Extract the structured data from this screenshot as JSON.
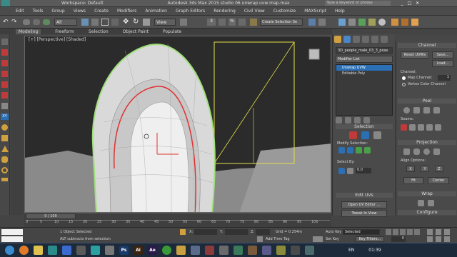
{
  "title": {
    "workspace": "Workspace: Default",
    "app_title": "Autodesk 3ds Max 2015  studio 06 unwrap uvw map.max",
    "search_placeholder": "Type a keyword or phrase"
  },
  "menu": [
    "Edit",
    "Tools",
    "Group",
    "Views",
    "Create",
    "Modifiers",
    "Animation",
    "Graph Editors",
    "Rendering",
    "Civil View",
    "Customize",
    "MAXScript",
    "Help"
  ],
  "toolbar": {
    "selection_filter": "All",
    "ref_coord": "View",
    "sel_set": "Create Selection Se"
  },
  "ribbon_tabs": [
    "Modeling",
    "Freeform",
    "Selection",
    "Object Paint",
    "Populate"
  ],
  "viewport": {
    "label": "[+] [Perspective] [Shaded]"
  },
  "command_panel": {
    "object_name": "3D_people_male_03_3_pose",
    "modifier_list": "Modifier List",
    "stack": [
      "Unwrap UVW",
      "Editable Poly"
    ],
    "selection_title": "Selection",
    "modify_selection": "Modify Selection:",
    "select_by": "Select By:",
    "select_by_value": "0.0",
    "edit_uvs_title": "Edit UVs",
    "open_uv_editor": "Open UV Editor ...",
    "tweak_in_view": "Tweak In View"
  },
  "uv_panel": {
    "channel_title": "Channel",
    "reset_uvws": "Reset UVWs",
    "save": "Save...",
    "load": "Load...",
    "channel_label": "Channel:",
    "map_channel_label": "Map Channel:",
    "map_channel_value": "1",
    "vertex_color_channel": "Vertex Color Channel",
    "peel_title": "Peel",
    "seams_label": "Seams:",
    "projection_title": "Projection",
    "align_options": "Align Options:",
    "align": [
      "X",
      "Y",
      "Z"
    ],
    "fit": "Fit",
    "center": "Center",
    "wrap_title": "Wrap",
    "configure_title": "Configure"
  },
  "timeline": {
    "frame": "0 / 100",
    "ticks": [
      "0",
      "5",
      "10",
      "15",
      "20",
      "25",
      "30",
      "35",
      "40",
      "45",
      "50",
      "55",
      "60",
      "65",
      "70",
      "75",
      "80",
      "85",
      "90",
      "95",
      "100"
    ]
  },
  "status": {
    "objects": "1 Object Selected",
    "hint": "ALT subtracts from selection",
    "x_label": "X:",
    "y_label": "Y:",
    "z_label": "Z:",
    "grid": "Grid = 0.254m",
    "add_time_tag": "Add Time Tag",
    "auto_key": "Auto Key",
    "set_key": "Set Key",
    "selected": "Selected",
    "key_filters": "Key Filters...",
    "frame_value": "0"
  },
  "taskbar": {
    "clock_time": "01:39",
    "lang": "EN"
  },
  "colors": {
    "accent_blue": "#2b6fb5",
    "selection_red": "#e03030",
    "highlight_green": "#9fe07a"
  }
}
